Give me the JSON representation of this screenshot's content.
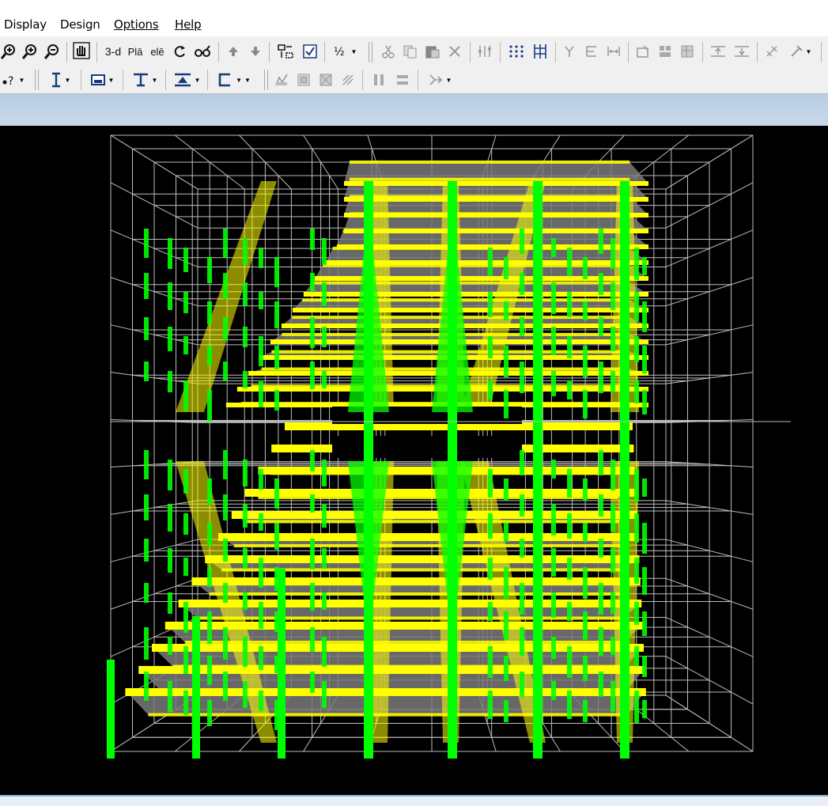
{
  "menu": {
    "items": [
      {
        "label": "Display",
        "mnemonic_underline": false
      },
      {
        "label": "Design",
        "mnemonic_underline": false
      },
      {
        "label": "Options",
        "mnemonic_underline": true
      },
      {
        "label": "Help",
        "mnemonic_underline": true
      }
    ]
  },
  "toolbar": {
    "view_3d_label": "3-d",
    "plan_label": "Plā",
    "elev_label": "elē",
    "zoom_in_icon": "zoom-in-icon",
    "zoom_out_icon": "zoom-out-icon",
    "pan_icon": "pan-hand-icon"
  },
  "colors": {
    "viewport_bg": "#000000",
    "grid": "#bdbdbd",
    "beam": "#ffff00",
    "column": "#00ff00",
    "slab": "#7a7a7a",
    "title_strip": "#bfd2e6"
  }
}
